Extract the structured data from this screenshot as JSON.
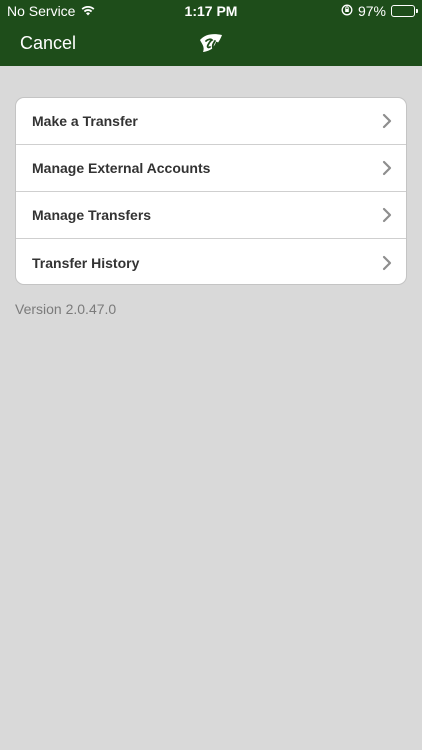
{
  "status": {
    "carrier": "No Service",
    "time": "1:17 PM",
    "battery": "97%",
    "battery_level": 0.97
  },
  "nav": {
    "cancel_label": "Cancel",
    "logo_icon": "green-leaf-logo-icon"
  },
  "menu": {
    "items": [
      {
        "label": "Make a Transfer"
      },
      {
        "label": "Manage External Accounts"
      },
      {
        "label": "Manage Transfers"
      },
      {
        "label": "Transfer History"
      }
    ]
  },
  "footer": {
    "version": "Version 2.0.47.0"
  },
  "colors": {
    "header_bg": "#1e4d1a",
    "page_bg": "#d9d9d9"
  }
}
